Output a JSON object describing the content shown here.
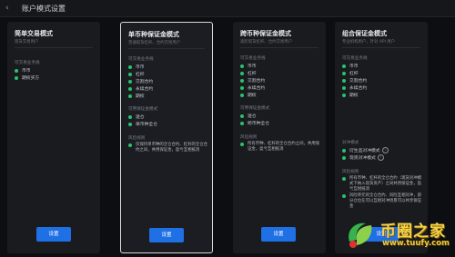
{
  "header": {
    "back_icon": "chevron-left-icon",
    "title": "账户模式设置"
  },
  "cards": [
    {
      "name": "简单交易模式",
      "desc": "现货交易用户",
      "sections": [
        {
          "title": "可交易业务线",
          "items": [
            "币币",
            "期权买方"
          ]
        }
      ],
      "risk": null,
      "button": "设置"
    },
    {
      "name": "单币种保证金模式",
      "desc": "普通现货杠杆、合约交易用户",
      "sections": [
        {
          "title": "可交易业务线",
          "items": [
            "币币",
            "杠杆",
            "交割合约",
            "永续合约",
            "期权"
          ]
        },
        {
          "title": "可用保证金模式",
          "items": [
            "逐仓",
            "单币种全仓"
          ]
        }
      ],
      "risk": {
        "title": "风险规则",
        "text": "仅保持单币种的全仓合约、杠杆的全仓合约之间，共用保证金，盈亏互相抵消"
      },
      "button": "设置"
    },
    {
      "name": "跨币种保证金模式",
      "desc": "高阶现货杠杆、合约交易用户",
      "sections": [
        {
          "title": "可交易业务线",
          "items": [
            "币币",
            "杠杆",
            "交割合约",
            "永续合约",
            "期权"
          ]
        },
        {
          "title": "可用保证金模式",
          "items": [
            "逐仓",
            "跨币种全仓"
          ]
        }
      ],
      "risk": {
        "title": "风险规则",
        "text": "所有币种、杠杆的全仓合约之间，共用保证金，盈亏互相抵消"
      },
      "button": "设置"
    },
    {
      "name": "组合保证金模式",
      "desc": "专业机构用户，针对 API 用户",
      "sections": [
        {
          "title": "可交易业务线",
          "items": [
            "币币",
            "杠杆",
            "交割合约",
            "永续合约",
            "期权"
          ]
        },
        {
          "title": "对冲模式",
          "items": [
            "衍生品对冲模式",
            "现货对冲模式"
          ]
        }
      ],
      "risk": {
        "title": "风险规则",
        "items": [
          "所有币种、杠杆的全仓合约（现货对冲模式下纳入现货资产）之间共用保证金，盈亏互相抵消",
          "风险单元的全仓合约、风险互相对冲，部分仓位在可以互相对冲场景可以共享保证金"
        ]
      },
      "button": "设置"
    }
  ],
  "watermark": {
    "text": "币圈之家",
    "url": "www.tuufy.com"
  },
  "colors": {
    "accent": "#1f6fe5",
    "dot": "#29c26d",
    "background": "#0d0e11",
    "card": "#1a1b1f"
  }
}
